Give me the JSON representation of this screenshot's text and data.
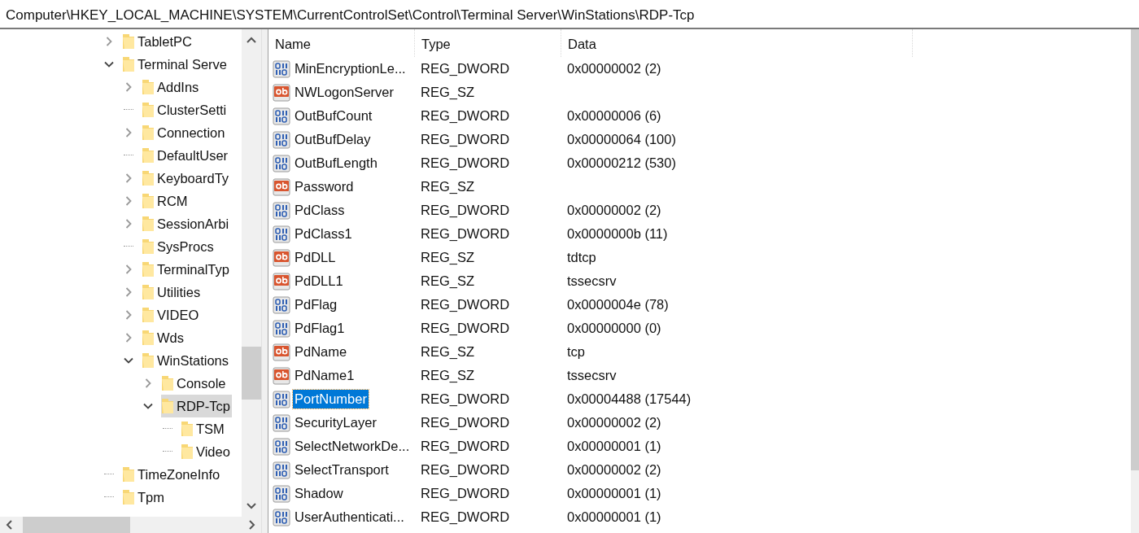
{
  "address_bar": {
    "path": "Computer\\HKEY_LOCAL_MACHINE\\SYSTEM\\CurrentControlSet\\Control\\Terminal Server\\WinStations\\RDP-Tcp"
  },
  "tree": [
    {
      "label": "TabletPC",
      "expanded": false,
      "selected": false
    },
    {
      "label": "Terminal Serve",
      "expanded": true,
      "selected": false,
      "children": [
        {
          "label": "AddIns",
          "expanded": false,
          "selected": false
        },
        {
          "label": "ClusterSetti",
          "selected": false
        },
        {
          "label": "Connection",
          "expanded": false,
          "selected": false
        },
        {
          "label": "DefaultUser",
          "selected": false
        },
        {
          "label": "KeyboardTy",
          "expanded": false,
          "selected": false
        },
        {
          "label": "RCM",
          "expanded": false,
          "selected": false
        },
        {
          "label": "SessionArbi",
          "expanded": false,
          "selected": false
        },
        {
          "label": "SysProcs",
          "selected": false
        },
        {
          "label": "TerminalTyp",
          "expanded": false,
          "selected": false
        },
        {
          "label": "Utilities",
          "expanded": false,
          "selected": false
        },
        {
          "label": "VIDEO",
          "expanded": false,
          "selected": false
        },
        {
          "label": "Wds",
          "expanded": false,
          "selected": false
        },
        {
          "label": "WinStations",
          "expanded": true,
          "selected": false,
          "children": [
            {
              "label": "Console",
              "expanded": false,
              "selected": false
            },
            {
              "label": "RDP-Tcp",
              "expanded": true,
              "selected": true,
              "children": [
                {
                  "label": "TSM",
                  "selected": false
                },
                {
                  "label": "Video",
                  "selected": false
                }
              ]
            }
          ]
        }
      ]
    },
    {
      "label": "TimeZoneInfo",
      "selected": false
    },
    {
      "label": "Tpm",
      "selected": false
    }
  ],
  "table": {
    "columns": [
      "Name",
      "Type",
      "Data"
    ],
    "rows": [
      {
        "kind": "dword",
        "name": "MinEncryptionLe...",
        "type": "REG_DWORD",
        "data": "0x00000002 (2)",
        "selected": false
      },
      {
        "kind": "sz",
        "name": "NWLogonServer",
        "type": "REG_SZ",
        "selected": false
      },
      {
        "kind": "dword",
        "name": "OutBufCount",
        "type": "REG_DWORD",
        "data": "0x00000006 (6)",
        "selected": false
      },
      {
        "kind": "dword",
        "name": "OutBufDelay",
        "type": "REG_DWORD",
        "data": "0x00000064 (100)",
        "selected": false
      },
      {
        "kind": "dword",
        "name": "OutBufLength",
        "type": "REG_DWORD",
        "data": "0x00000212 (530)",
        "selected": false
      },
      {
        "kind": "sz",
        "name": "Password",
        "type": "REG_SZ",
        "selected": false
      },
      {
        "kind": "dword",
        "name": "PdClass",
        "type": "REG_DWORD",
        "data": "0x00000002 (2)",
        "selected": false
      },
      {
        "kind": "dword",
        "name": "PdClass1",
        "type": "REG_DWORD",
        "data": "0x0000000b (11)",
        "selected": false
      },
      {
        "kind": "sz",
        "name": "PdDLL",
        "type": "REG_SZ",
        "data": "tdtcp",
        "selected": false
      },
      {
        "kind": "sz",
        "name": "PdDLL1",
        "type": "REG_SZ",
        "data": "tssecsrv",
        "selected": false
      },
      {
        "kind": "dword",
        "name": "PdFlag",
        "type": "REG_DWORD",
        "data": "0x0000004e (78)",
        "selected": false
      },
      {
        "kind": "dword",
        "name": "PdFlag1",
        "type": "REG_DWORD",
        "data": "0x00000000 (0)",
        "selected": false
      },
      {
        "kind": "sz",
        "name": "PdName",
        "type": "REG_SZ",
        "data": "tcp",
        "selected": false
      },
      {
        "kind": "sz",
        "name": "PdName1",
        "type": "REG_SZ",
        "data": "tssecsrv",
        "selected": false
      },
      {
        "kind": "dword",
        "name": "PortNumber",
        "type": "REG_DWORD",
        "data": "0x00004488 (17544)",
        "selected": true
      },
      {
        "kind": "dword",
        "name": "SecurityLayer",
        "type": "REG_DWORD",
        "data": "0x00000002 (2)",
        "selected": false
      },
      {
        "kind": "dword",
        "name": "SelectNetworkDe...",
        "type": "REG_DWORD",
        "data": "0x00000001 (1)",
        "selected": false
      },
      {
        "kind": "dword",
        "name": "SelectTransport",
        "type": "REG_DWORD",
        "data": "0x00000002 (2)",
        "selected": false
      },
      {
        "kind": "dword",
        "name": "Shadow",
        "type": "REG_DWORD",
        "data": "0x00000001 (1)",
        "selected": false
      },
      {
        "kind": "dword",
        "name": "UserAuthenticati...",
        "type": "REG_DWORD",
        "data": "0x00000001 (1)",
        "selected": false
      }
    ]
  }
}
